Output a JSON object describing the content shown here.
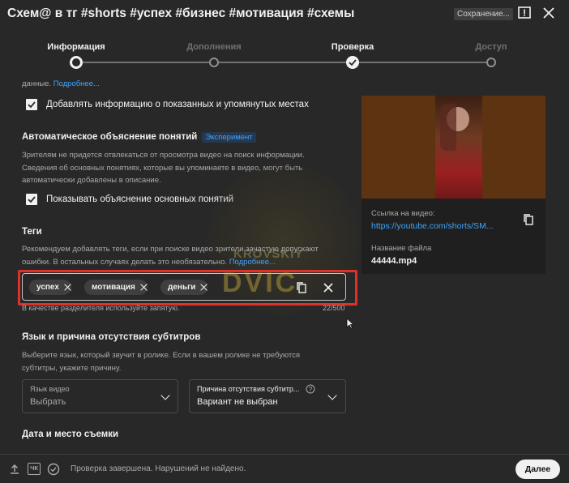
{
  "header": {
    "title": "Схем@ в тг #shorts #успех #бизнес #мотивация #схемы",
    "saving_badge": "Сохранение...",
    "alert_icon": "feedback-icon",
    "close_icon": "close-icon"
  },
  "stepper": {
    "steps": [
      {
        "label": "Информация",
        "state": "current"
      },
      {
        "label": "Дополнения",
        "state": "future"
      },
      {
        "label": "Проверка",
        "state": "done"
      },
      {
        "label": "Доступ",
        "state": "future"
      }
    ]
  },
  "details": {
    "intro_text": "данные.",
    "intro_more": "Подробнее...",
    "places_checkbox": {
      "label": "Добавлять информацию о показанных и упомянутых местах",
      "checked": true
    },
    "concepts_title": "Автоматическое объяснение понятий",
    "concepts_badge": "Эксперимент",
    "concepts_desc_1": "Зрителям не придется отвлекаться от просмотра видео на поиск информации.",
    "concepts_desc_2": "Сведения об основных понятиях, которые вы упоминаете в видео, могут быть",
    "concepts_desc_3": "автоматически добавлены в описание.",
    "concepts_checkbox": {
      "label": "Показывать объяснение основных понятий",
      "checked": true
    },
    "tags_title": "Теги",
    "tags_desc_1": "Рекомендуем добавлять теги, если при поиске видео зрители зачастую допускают",
    "tags_desc_2": "ошибки. В остальных случаях делать это необязательно.",
    "tags_more": "Подробнее...",
    "tags": [
      "успех",
      "мотивация",
      "деньги"
    ],
    "tags_hint": "В качестве разделителя используйте запятую.",
    "tags_count": "22/500",
    "lang_title": "Язык и причина отсутствия субтитров",
    "lang_desc_1": "Выберите язык, который звучит в ролике. Если в вашем ролике не требуются",
    "lang_desc_2": "субтитры, укажите причину.",
    "lang_select": {
      "label": "Язык видео",
      "value": "Выбрать"
    },
    "reason_select": {
      "label": "Причина отсутствия субтитр...",
      "value": "Вариант не выбран"
    },
    "date_title": "Дата и место съемки"
  },
  "preview": {
    "link_label": "Ссылка на видео:",
    "link_value": "https://youtube.com/shorts/SM...",
    "file_label": "Название файла",
    "file_value": "44444.mp4"
  },
  "watermark": {
    "text_top": "KROVSKIY",
    "text_big": "DVIC"
  },
  "footer": {
    "status": "Проверка завершена. Нарушений не найдено.",
    "next_label": "Далее",
    "cc_label": "ЧК"
  },
  "colors": {
    "background": "#282828",
    "accent_link": "#3ea6ff",
    "highlight": "#e0302a"
  }
}
